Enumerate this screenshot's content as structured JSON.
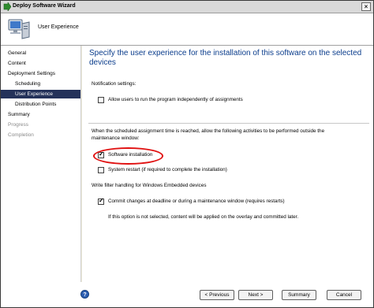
{
  "window": {
    "title": "Deploy Software Wizard",
    "close_label": "×"
  },
  "header": {
    "step_title": "User Experience"
  },
  "sidebar": {
    "items": [
      {
        "label": "General",
        "state": "normal"
      },
      {
        "label": "Content",
        "state": "normal"
      },
      {
        "label": "Deployment Settings",
        "state": "normal"
      },
      {
        "label": "Scheduling",
        "state": "normal"
      },
      {
        "label": "User Experience",
        "state": "selected"
      },
      {
        "label": "Distribution Points",
        "state": "normal"
      },
      {
        "label": "Summary",
        "state": "normal"
      },
      {
        "label": "Progress",
        "state": "disabled"
      },
      {
        "label": "Completion",
        "state": "disabled"
      }
    ]
  },
  "main": {
    "heading": "Specify the user experience for the installation of this software on the selected devices",
    "notification_label": "Notification settings:",
    "allow_users_label": "Allow users to run the program independently of assignments",
    "allow_users_checked": false,
    "maintenance_text": "When the scheduled assignment time is reached, allow the following activities to be performed outside the maintenance window:",
    "software_install_label": "Software installation",
    "software_install_checked": true,
    "system_restart_label": "System restart  (if required to complete the installation)",
    "system_restart_checked": false,
    "write_filter_label": "Write filter handling for Windows Embedded devices",
    "commit_changes_label": "Commit changes at deadline or during a maintenance window (requires restarts)",
    "commit_changes_checked": true,
    "commit_note": "If this option is not selected, content will be applied on the overlay and committed later.",
    "tick_glyph": "✓"
  },
  "footer": {
    "help_label": "?",
    "previous_label": "< Previous",
    "next_label": "Next >",
    "summary_label": "Summary",
    "cancel_label": "Cancel"
  },
  "colors": {
    "selected_nav": "#24325a",
    "heading": "#0b3d8c",
    "highlight": "#e01010"
  }
}
